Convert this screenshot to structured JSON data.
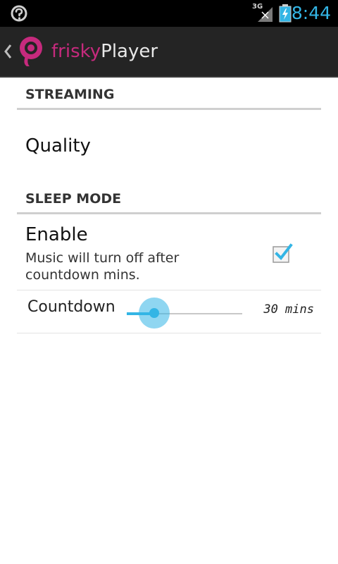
{
  "status_bar": {
    "left_icon": "question-ring-icon",
    "network_label": "3G",
    "signal_icon": "signal-icon",
    "battery_icon": "battery-charging-icon",
    "clock": "8:44"
  },
  "action_bar": {
    "up_icon": "chevron-left-icon",
    "logo_icon": "app-logo-icon",
    "title_part1": "frisky",
    "title_part2": "Player"
  },
  "settings": {
    "streaming_header": "STREAMING",
    "quality_label": "Quality",
    "sleep_header": "SLEEP MODE",
    "enable": {
      "title": "Enable",
      "summary": "Music will turn off after countdown mins.",
      "checked": true
    },
    "countdown": {
      "label": "Countdown",
      "value_text": "30 mins",
      "level": 0.24
    }
  },
  "colors": {
    "accent": "#33b5e5",
    "brand": "#c62a7d",
    "action_bar_bg": "#242424",
    "status_bar_bg": "#000000"
  }
}
